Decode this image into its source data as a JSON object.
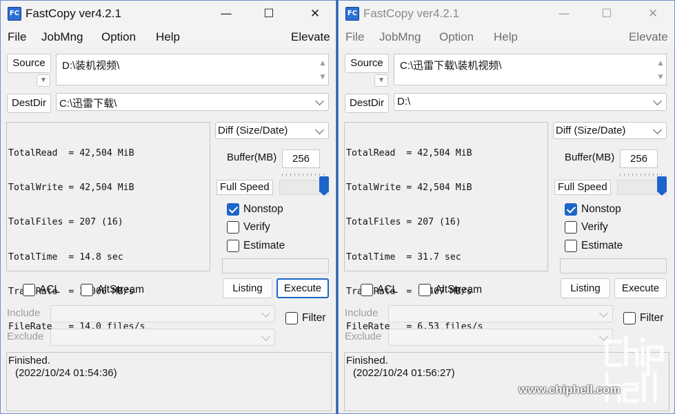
{
  "windows": [
    {
      "active": true,
      "app_icon": "FC",
      "title": "FastCopy ver4.2.1",
      "menu": [
        "File",
        "JobMng",
        "Option",
        "Help"
      ],
      "elevate": "Elevate",
      "source_label": "Source",
      "source_value": "D:\\装机视频\\",
      "destdir_label": "DestDir",
      "destdir_value": "C:\\迅雷下载\\",
      "stats": [
        "TotalRead  = 42,504 MiB",
        "TotalWrite = 42,504 MiB",
        "TotalFiles = 207 (16)",
        "TotalTime  = 14.8 sec",
        "TransRate  = 3,006 MB/s",
        "FileRate   = 14.0 files/s"
      ],
      "mode": "Diff (Size/Date)",
      "buffer_label": "Buffer(MB)",
      "buffer_value": "256",
      "speed_label": "Full Speed",
      "speed_level": 1.0,
      "nonstop_label": "Nonstop",
      "nonstop_checked": true,
      "verify_label": "Verify",
      "verify_checked": false,
      "estimate_label": "Estimate",
      "estimate_checked": false,
      "acl_label": "ACL",
      "acl_checked": false,
      "altstream_label": "AltStream",
      "altstream_checked": false,
      "listing_label": "Listing",
      "execute_label": "Execute",
      "include_label": "Include",
      "exclude_label": "Exclude",
      "filter_label": "Filter",
      "filter_checked": false,
      "status_line1": "Finished.",
      "status_line2": "(2022/10/24 01:54:36)"
    },
    {
      "active": false,
      "app_icon": "FC",
      "title": "FastCopy ver4.2.1",
      "menu": [
        "File",
        "JobMng",
        "Option",
        "Help"
      ],
      "elevate": "Elevate",
      "source_label": "Source",
      "source_value": "C:\\迅雷下载\\装机视频\\",
      "destdir_label": "DestDir",
      "destdir_value": "D:\\",
      "stats": [
        "TotalRead  = 42,504 MiB",
        "TotalWrite = 42,504 MiB",
        "TotalFiles = 207 (16)",
        "TotalTime  = 31.7 sec",
        "TransRate  = 1,407 MB/s",
        "FileRate   = 6.53 files/s"
      ],
      "mode": "Diff (Size/Date)",
      "buffer_label": "Buffer(MB)",
      "buffer_value": "256",
      "speed_label": "Full Speed",
      "speed_level": 1.0,
      "nonstop_label": "Nonstop",
      "nonstop_checked": true,
      "verify_label": "Verify",
      "verify_checked": false,
      "estimate_label": "Estimate",
      "estimate_checked": false,
      "acl_label": "ACL",
      "acl_checked": false,
      "altstream_label": "AltStream",
      "altstream_checked": false,
      "listing_label": "Listing",
      "execute_label": "Execute",
      "include_label": "Include",
      "exclude_label": "Exclude",
      "filter_label": "Filter",
      "filter_checked": false,
      "status_line1": "Finished.",
      "status_line2": "(2022/10/24 01:56:27)"
    }
  ],
  "watermark": {
    "logo": "chip hell",
    "url": "www.chiphell.com"
  },
  "colors": {
    "accent": "#1c64c8",
    "desktop": "#1f5fb0",
    "window_bg": "#f0f0f0"
  }
}
